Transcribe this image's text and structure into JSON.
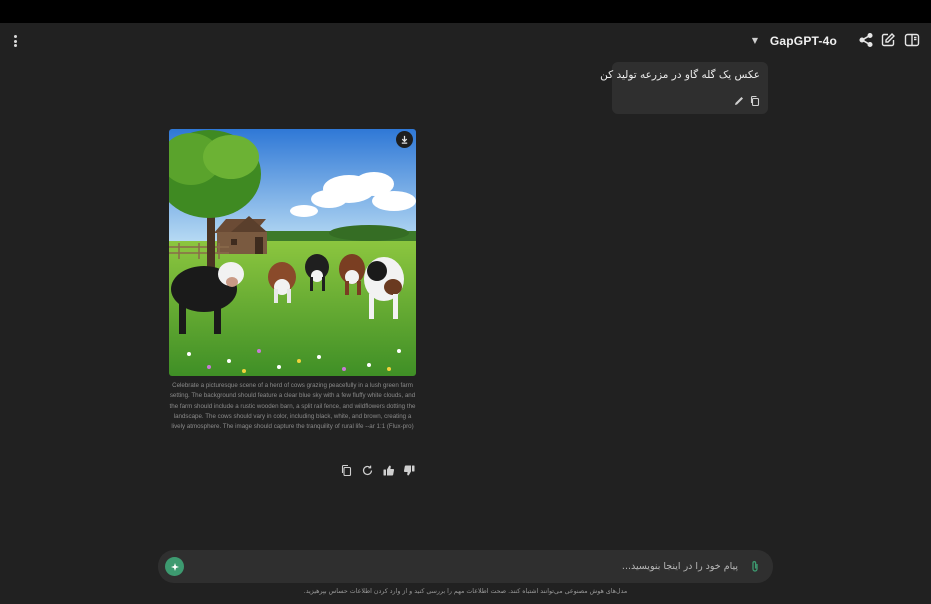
{
  "header": {
    "model_label": "GapGPT-4o",
    "icons": [
      "more-vertical-icon",
      "chevron-down-icon",
      "share-icon",
      "edit-icon",
      "sidebar-icon"
    ]
  },
  "conversation": {
    "user_message": "عکس یک گله گاو در مزرعه تولید کن",
    "assistant": {
      "image_description": "herd of cows grazing in a green farm meadow with a wooden barn and tree",
      "caption": "Celebrate a picturesque scene of a herd of cows grazing peacefully in a lush green farm setting. The background should feature a clear blue sky with a few fluffy white clouds, and the farm should include a rustic wooden barn, a split rail fence, and wildflowers dotting the landscape. The cows should vary in color, including black, white, and brown, creating a lively atmosphere. The image should capture the tranquility of rural life --ar 1:1 (Flux-pro)"
    }
  },
  "composer": {
    "placeholder": "پیام خود را در اینجا بنویسید...",
    "value": ""
  },
  "disclaimer": "مدل‌های هوش مصنوعی می‌توانند اشتباه کنند. صحت اطلاعات مهم را بررسی کنید و از وارد کردن اطلاعات حساس بپرهیزید.",
  "colors": {
    "background": "#212121",
    "bubble": "#2f2f2f",
    "send_button": "#3d9a70",
    "top_strip": "#000000"
  }
}
